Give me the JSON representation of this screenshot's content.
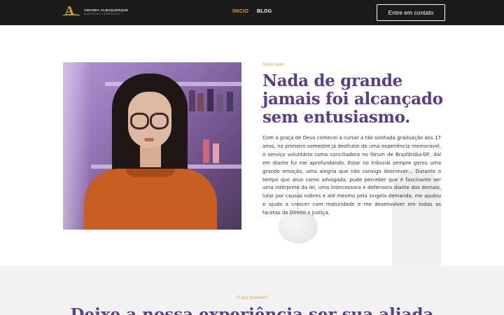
{
  "nav": {
    "logo": {
      "name": "AMANDA ALBUQUERQUE",
      "tagline": "ADVOCACIA E CONSULTORIA"
    },
    "links": [
      {
        "label": "INICIO",
        "active": true
      },
      {
        "label": "BLOG",
        "active": false
      }
    ],
    "cta_label": "Entre em contato"
  },
  "about": {
    "eyebrow": "Sobre mim",
    "heading": "Nada de grande jamais foi alcançado sem entusiasmo.",
    "paragraph": "Com a graça de Deus comecei a cursar a tão sonhada graduação aos 17 anos, no primeiro semestre já desfrutei de uma experiência memorável, o serviço voluntário como conciliadora no fórum de Brazlândia-DF, daí em diante fui me aprofundando. Estar no tribunal sempre gerou uma grande emoção, uma alegria que não consigo descrever… Durante o tempo que atuo como advogada, pude perceber que é fascinante ser uma intérprete da lei, uma intercessora e defensora diante dos demais, lutar por causas nobres e até mesmo pela singela demanda, me ajudou e ajuda a crescer com maturidade e me desenvolver em todas as facetas do Direito x Justiça."
  },
  "services": {
    "eyebrow": "O que fazemos?",
    "heading": "Deixe a nossa experiência ser sua aliada"
  },
  "colors": {
    "nav_bg": "#1b1b1b",
    "accent_gold": "#d8a12f",
    "heading_purple": "#5c3d8a"
  }
}
